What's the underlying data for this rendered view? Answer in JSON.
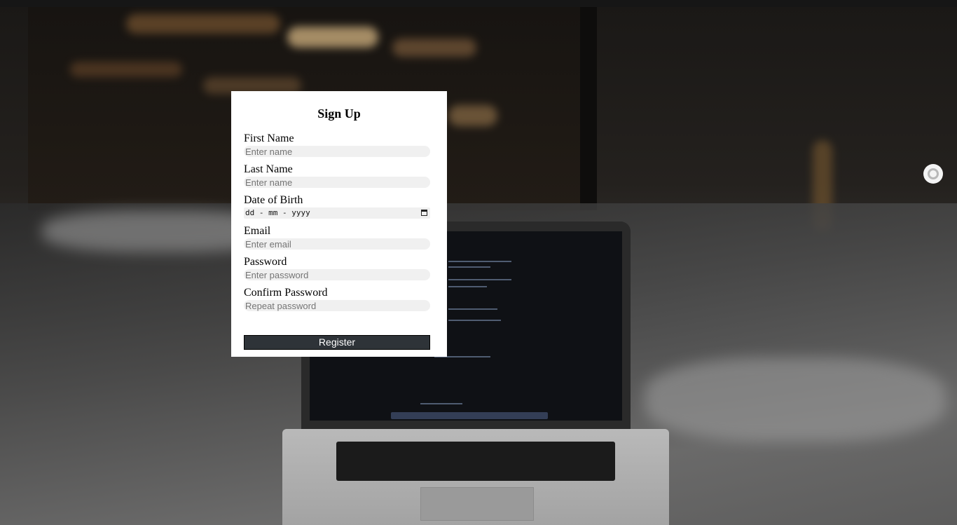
{
  "form": {
    "title": "Sign Up",
    "fields": [
      {
        "label": "First Name",
        "placeholder": "Enter name"
      },
      {
        "label": "Last Name",
        "placeholder": "Enter name"
      },
      {
        "label": "Date of Birth",
        "placeholder": "dd - mm - yyyy"
      },
      {
        "label": "Email",
        "placeholder": "Enter email"
      },
      {
        "label": "Password",
        "placeholder": "Enter password"
      },
      {
        "label": "Confirm Password",
        "placeholder": "Repeat password"
      }
    ],
    "submit_label": "Register"
  },
  "icons": {
    "calendar": "calendar-icon",
    "side_widget": "settings-ring-icon"
  }
}
